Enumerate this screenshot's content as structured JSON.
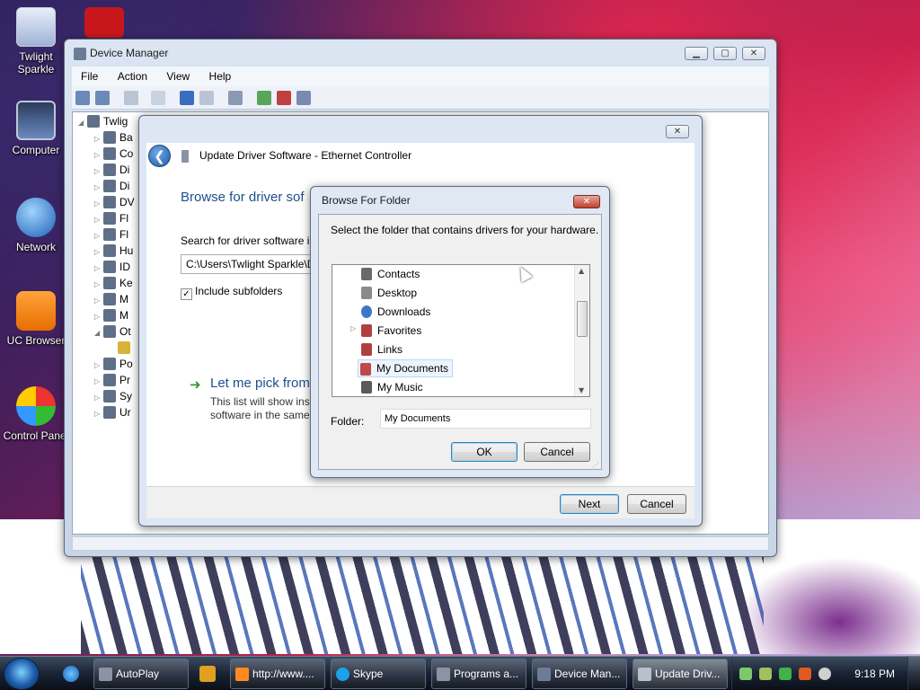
{
  "desktop": {
    "icons": [
      {
        "label_line1": "Twlight",
        "label_line2": "Sparkle"
      },
      {
        "label_line1": "Computer",
        "label_line2": ""
      },
      {
        "label_line1": "Network",
        "label_line2": ""
      },
      {
        "label_line1": "UC Browser",
        "label_line2": ""
      },
      {
        "label_line1": "Control Panel",
        "label_line2": ""
      }
    ]
  },
  "device_manager": {
    "title": "Device Manager",
    "menu": [
      "File",
      "Action",
      "View",
      "Help"
    ],
    "tree_root": "Twlig",
    "tree_items": [
      "Ba",
      "Co",
      "Di",
      "Di",
      "DV",
      "Fl",
      "Fl",
      "Hu",
      "ID",
      "Ke",
      "M",
      "M",
      "Ot",
      "",
      "Po",
      "Pr",
      "Sy",
      "Ur"
    ]
  },
  "update_driver": {
    "title": "Update Driver Software - Ethernet Controller",
    "heading": "Browse for driver sof",
    "search_label": "Search for driver software in",
    "path_value": "C:\\Users\\Twlight Sparkle\\D",
    "include_subfolders_label": "Include subfolders",
    "include_subfolders_checked": true,
    "pick_link": "Let me pick from",
    "pick_desc_line1": "This list will show inst",
    "pick_desc_line2": "software in the same",
    "next_label": "Next",
    "cancel_label": "Cancel"
  },
  "browse_folder": {
    "title": "Browse For Folder",
    "instruction": "Select the folder that contains drivers for your hardware.",
    "folders": [
      {
        "name": "Contacts",
        "expandable": false,
        "selected": false
      },
      {
        "name": "Desktop",
        "expandable": false,
        "selected": false
      },
      {
        "name": "Downloads",
        "expandable": false,
        "selected": false
      },
      {
        "name": "Favorites",
        "expandable": true,
        "selected": false
      },
      {
        "name": "Links",
        "expandable": false,
        "selected": false
      },
      {
        "name": "My Documents",
        "expandable": false,
        "selected": true
      },
      {
        "name": "My Music",
        "expandable": false,
        "selected": false
      }
    ],
    "folder_label": "Folder:",
    "folder_value": "My Documents",
    "ok_label": "OK",
    "cancel_label": "Cancel"
  },
  "taskbar": {
    "tasks": [
      {
        "label": "AutoPlay"
      },
      {
        "label": "http://www...."
      },
      {
        "label": "Skype"
      },
      {
        "label": "Programs a..."
      },
      {
        "label": "Device Man..."
      },
      {
        "label": "Update Driv..."
      }
    ],
    "clock": "9:18 PM"
  },
  "colors": {
    "accent_link": "#1e5aa8",
    "heading_blue": "#1e4e8c",
    "arrow_green": "#2e9a2e"
  }
}
